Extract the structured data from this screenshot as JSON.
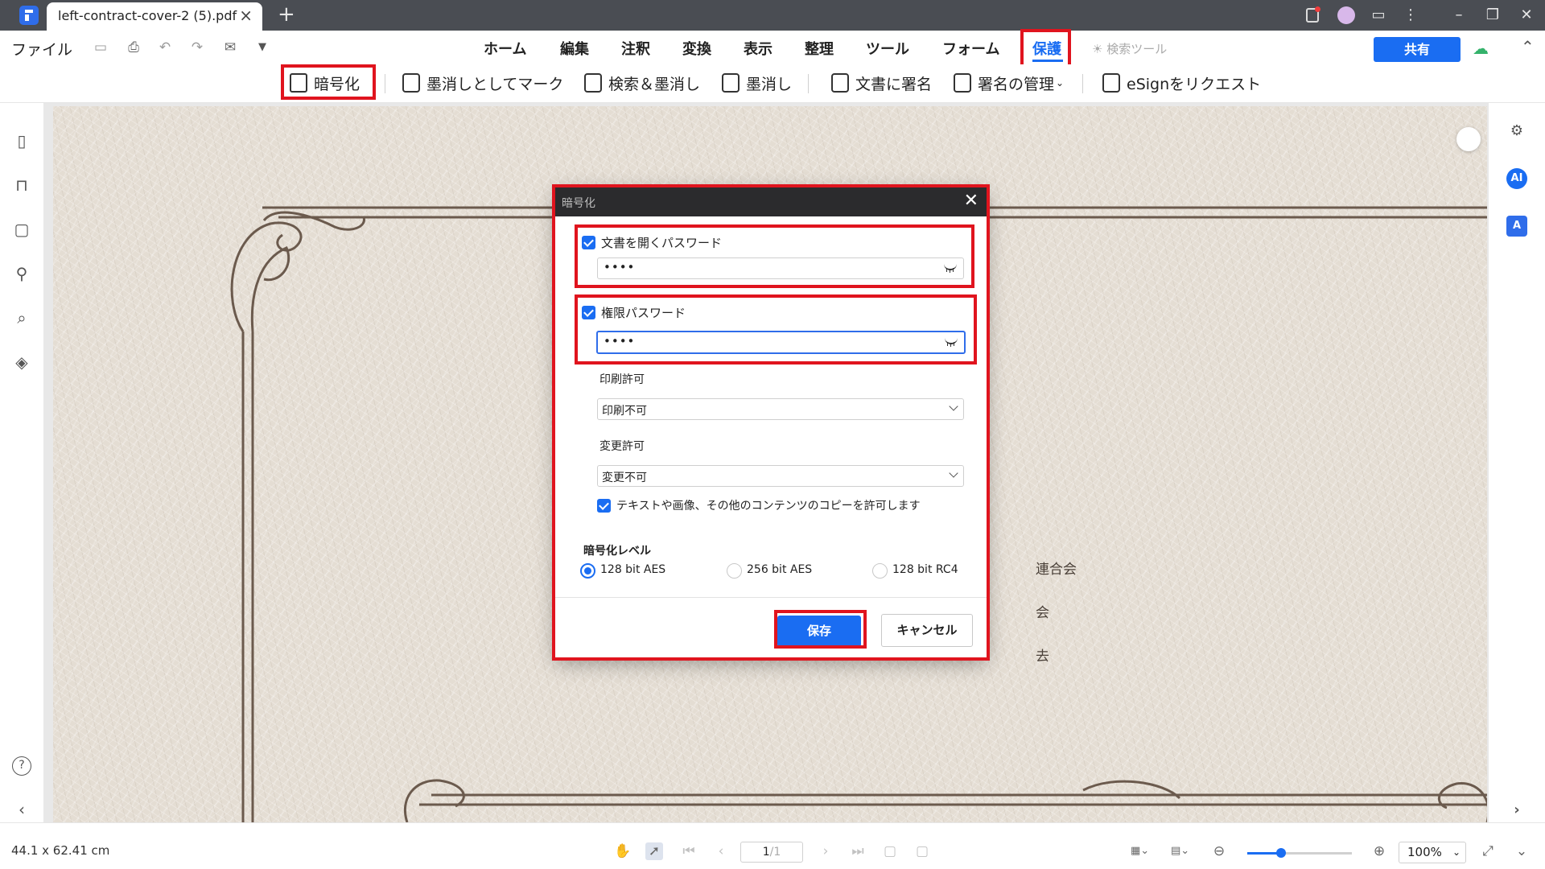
{
  "titlebar": {
    "tab_title": "left-contract-cover-2 (5).pdf",
    "tab_close": "×",
    "new_tab": "+"
  },
  "menubar": {
    "file": "ファイル",
    "tabs": [
      "ホーム",
      "編集",
      "注釈",
      "変換",
      "表示",
      "整理",
      "ツール",
      "フォーム",
      "保護"
    ],
    "active_tab": "保護",
    "search_tool": "検索ツール",
    "share": "共有"
  },
  "toolbar": {
    "items": [
      {
        "label": "暗号化",
        "icon": "lock-icon"
      },
      {
        "label": "墨消しとしてマーク",
        "icon": "mark-redaction-icon"
      },
      {
        "label": "検索＆墨消し",
        "icon": "search-redact-icon"
      },
      {
        "label": "墨消し",
        "icon": "redact-icon"
      },
      {
        "label": "文書に署名",
        "icon": "sign-document-icon"
      },
      {
        "label": "署名の管理",
        "icon": "manage-signature-icon"
      },
      {
        "label": "eSignをリクエスト",
        "icon": "esign-request-icon"
      }
    ]
  },
  "page": {
    "text_lines": [
      "連合会",
      "会",
      "去"
    ]
  },
  "dialog": {
    "title": "暗号化",
    "open_password": {
      "label": "文書を開くパスワード",
      "checked": true,
      "value": "••••"
    },
    "permission_password": {
      "label": "権限パスワード",
      "checked": true,
      "value": "••••"
    },
    "print": {
      "label": "印刷許可",
      "value": "印刷不可"
    },
    "change": {
      "label": "変更許可",
      "value": "変更不可"
    },
    "copy_allow": {
      "label": "テキストや画像、その他のコンテンツのコピーを許可します",
      "checked": true
    },
    "encryption_level": {
      "label": "暗号化レベル",
      "options": [
        "128 bit AES",
        "256 bit AES",
        "128 bit RC4"
      ],
      "selected": "128 bit AES"
    },
    "save": "保存",
    "cancel": "キャンセル"
  },
  "statusbar": {
    "page_size": "44.1 x 62.41 cm",
    "current_page": "1",
    "total_pages": "/1",
    "zoom": "100%",
    "zoom_fraction": 0.32
  },
  "colors": {
    "accent": "#1a6df2",
    "highlight_box": "#e0141e",
    "titlebar": "#4a4d53"
  }
}
